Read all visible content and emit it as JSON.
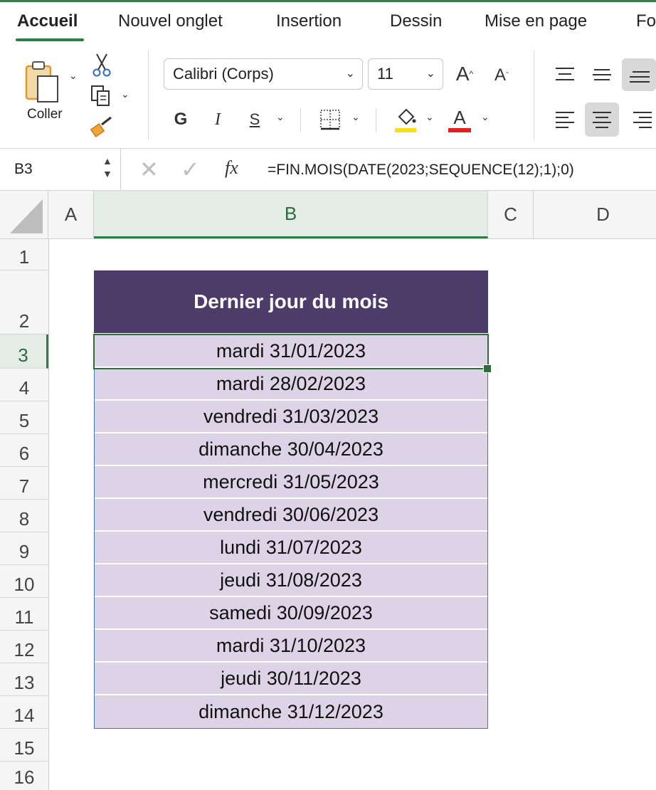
{
  "tabs": [
    {
      "label": "Accueil",
      "active": true
    },
    {
      "label": "Nouvel onglet"
    },
    {
      "label": "Insertion"
    },
    {
      "label": "Dessin"
    },
    {
      "label": "Mise en page"
    },
    {
      "label": "Fo"
    }
  ],
  "clipboard": {
    "paste_label": "Coller"
  },
  "font": {
    "name": "Calibri (Corps)",
    "size": "11",
    "bold": "G",
    "italic": "I",
    "underline": "S",
    "grow": "A",
    "shrink": "A",
    "color_letter": "A"
  },
  "colors": {
    "highlight": "#f7e018",
    "font_color": "#e01f1f",
    "accent": "#2d7d46",
    "table_header": "#4d3c69",
    "table_body": "#dcd3e7"
  },
  "formula_bar": {
    "cell_ref": "B3",
    "fx": "fx",
    "formula": "=FIN.MOIS(DATE(2023;SEQUENCE(12);1);0)"
  },
  "grid": {
    "columns": [
      "A",
      "B",
      "C",
      "D"
    ],
    "rows": [
      "1",
      "2",
      "3",
      "4",
      "5",
      "6",
      "7",
      "8",
      "9",
      "10",
      "11",
      "12",
      "13",
      "14",
      "15",
      "16"
    ],
    "selected_column": "B",
    "selected_row": "3"
  },
  "table": {
    "header": "Dernier jour du mois",
    "values": [
      "mardi 31/01/2023",
      "mardi 28/02/2023",
      "vendredi 31/03/2023",
      "dimanche 30/04/2023",
      "mercredi 31/05/2023",
      "vendredi 30/06/2023",
      "lundi 31/07/2023",
      "jeudi 31/08/2023",
      "samedi 30/09/2023",
      "mardi 31/10/2023",
      "jeudi 30/11/2023",
      "dimanche 31/12/2023"
    ]
  }
}
